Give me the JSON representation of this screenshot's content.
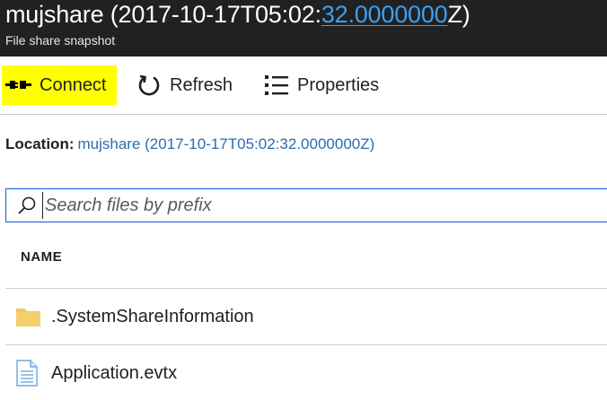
{
  "header": {
    "title_prefix": "mujshare (2017-10-17T05:02:",
    "title_highlight": "32.0000000",
    "title_suffix": "Z)",
    "subtitle": "File share snapshot",
    "highlight_color": "#3aa0f3"
  },
  "toolbar": {
    "connect_label": "Connect",
    "refresh_label": "Refresh",
    "properties_label": "Properties",
    "connect_highlight": "#ffff00"
  },
  "location": {
    "label": "Location:",
    "value": "mujshare (2017-10-17T05:02:32.0000000Z)"
  },
  "search": {
    "placeholder": "Search files by prefix",
    "value": ""
  },
  "table": {
    "column_name": "NAME",
    "rows": [
      {
        "name": ".SystemShareInformation",
        "icon": "folder-icon"
      },
      {
        "name": "Application.evtx",
        "icon": "file-icon"
      }
    ]
  }
}
